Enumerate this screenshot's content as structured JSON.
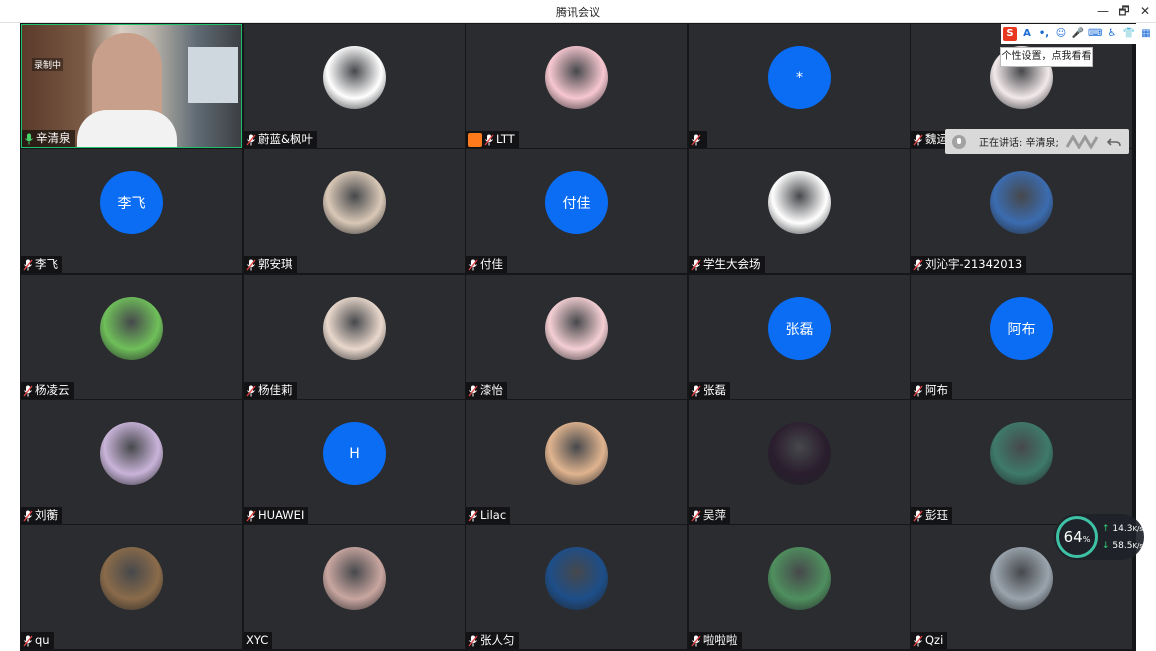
{
  "window": {
    "title": "腾讯会议",
    "minimize": "—",
    "restore": "🗗",
    "close": "✕"
  },
  "recording_label": "录制中",
  "tiles": [
    {
      "name": "辛清泉",
      "avatar_type": "video",
      "color": "#7a7168",
      "initial": ""
    },
    {
      "name": "蔚蓝&枫叶",
      "avatar_type": "image",
      "color": "#ffffff",
      "initial": ""
    },
    {
      "name": "LTT",
      "avatar_type": "image",
      "color": "#f7c7d0",
      "initial": "",
      "host": true
    },
    {
      "name": "",
      "avatar_type": "text",
      "color": "#0a6df3",
      "initial": "*"
    },
    {
      "name": "魏运",
      "avatar_type": "image",
      "color": "#f2e9ea",
      "initial": ""
    },
    {
      "name": "李飞",
      "avatar_type": "text",
      "color": "#0a6df3",
      "initial": "李飞"
    },
    {
      "name": "郭安琪",
      "avatar_type": "image",
      "color": "#d9c8b6",
      "initial": ""
    },
    {
      "name": "付佳",
      "avatar_type": "text",
      "color": "#0a6df3",
      "initial": "付佳"
    },
    {
      "name": "学生大会场",
      "avatar_type": "image",
      "color": "#ffffff",
      "initial": ""
    },
    {
      "name": "刘沁宇-21342013",
      "avatar_type": "image",
      "color": "#3b6cb0",
      "initial": ""
    },
    {
      "name": "杨凌云",
      "avatar_type": "image",
      "color": "#6fbf5a",
      "initial": ""
    },
    {
      "name": "杨佳莉",
      "avatar_type": "image",
      "color": "#e9d8cc",
      "initial": ""
    },
    {
      "name": "漆怡",
      "avatar_type": "image",
      "color": "#f4cfd3",
      "initial": ""
    },
    {
      "name": "张磊",
      "avatar_type": "text",
      "color": "#0a6df3",
      "initial": "张磊"
    },
    {
      "name": "阿布",
      "avatar_type": "text",
      "color": "#0a6df3",
      "initial": "阿布"
    },
    {
      "name": "刘蘅",
      "avatar_type": "image",
      "color": "#c9b4d9",
      "initial": ""
    },
    {
      "name": "HUAWEI",
      "avatar_type": "text",
      "color": "#0a6df3",
      "initial": "H"
    },
    {
      "name": "Lilac",
      "avatar_type": "image",
      "color": "#e0b48f",
      "initial": ""
    },
    {
      "name": "吴萍",
      "avatar_type": "image",
      "color": "#2a1d2e",
      "initial": ""
    },
    {
      "name": "彭珏",
      "avatar_type": "image",
      "color": "#3e7a6a",
      "initial": ""
    },
    {
      "name": "qu",
      "avatar_type": "image",
      "color": "#8a6b4a",
      "initial": ""
    },
    {
      "name": "XYC",
      "avatar_type": "image",
      "color": "#c9a6a0",
      "initial": "",
      "nomic": true
    },
    {
      "name": "张人匀",
      "avatar_type": "image",
      "color": "#1d4e89",
      "initial": ""
    },
    {
      "name": "啦啦啦",
      "avatar_type": "image",
      "color": "#4f8f5e",
      "initial": ""
    },
    {
      "name": "Qzi",
      "avatar_type": "image",
      "color": "#9aa4ad",
      "initial": ""
    }
  ],
  "speaking": {
    "label": "正在讲话: 辛清泉;"
  },
  "ime_toolbar": {
    "logo": "S",
    "items": [
      "A",
      "•,",
      "☺",
      "🎤",
      "⌨",
      "♿",
      "👕",
      "▦"
    ],
    "tooltip": "个性设置，点我看看"
  },
  "net": {
    "percent": "64",
    "percent_unit": "%",
    "up": "14.3",
    "up_unit": "K/s",
    "down": "58.5",
    "down_unit": "K/s"
  }
}
